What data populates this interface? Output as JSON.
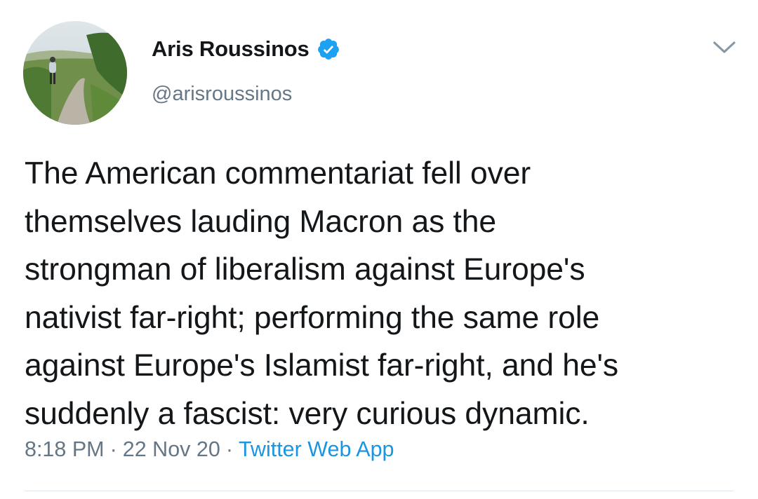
{
  "author": {
    "display_name": "Aris Roussinos",
    "handle": "@arisroussinos",
    "verified": true,
    "avatar_icon": "avatar-photo"
  },
  "tweet": {
    "text_lines": [
      "The American commentariat fell over",
      "themselves lauding Macron as the",
      "strongman of liberalism against Europe's",
      "nativist far-right; performing the same role",
      "against Europe's Islamist far-right, and he's",
      "suddenly a fascist: very curious dynamic."
    ],
    "time": "8:18 PM",
    "separator": "·",
    "date": "22 Nov 20",
    "source": "Twitter Web App"
  },
  "icons": {
    "verified": "verified-badge-icon",
    "menu": "chevron-down-icon"
  },
  "colors": {
    "text": "#14171a",
    "secondary": "#657786",
    "link": "#1b95e0",
    "verified": "#1da1f2",
    "divider": "#e1e8ed"
  }
}
